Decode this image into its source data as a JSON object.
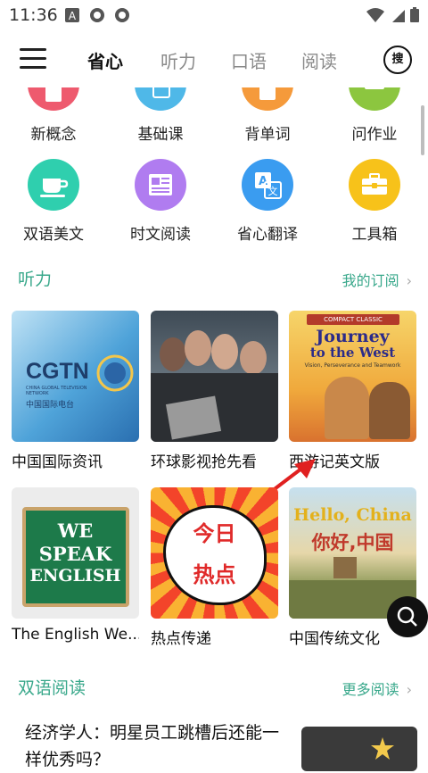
{
  "status": {
    "time": "11:36"
  },
  "tabs": [
    {
      "label": "省心"
    },
    {
      "label": "听力"
    },
    {
      "label": "口语"
    },
    {
      "label": "阅读"
    }
  ],
  "search_label": "搜",
  "grid_row1": [
    {
      "label": "新概念",
      "color": "#ee5a6e"
    },
    {
      "label": "基础课",
      "color": "#4fb8e8"
    },
    {
      "label": "背单词",
      "color": "#f59a3b"
    },
    {
      "label": "问作业",
      "color": "#8cc63f"
    }
  ],
  "grid_row2": [
    {
      "label": "双语美文",
      "color": "#2fcfae",
      "icon": "coffee-cup-icon"
    },
    {
      "label": "时文阅读",
      "color": "#b07cf0",
      "icon": "newspaper-icon"
    },
    {
      "label": "省心翻译",
      "color": "#3a9cf0",
      "icon": "translate-icon"
    },
    {
      "label": "工具箱",
      "color": "#f7c21a",
      "icon": "toolbox-icon"
    }
  ],
  "listening": {
    "title": "听力",
    "more": "我的订阅",
    "cards": [
      {
        "title": "中国国际资讯",
        "brand": "CGTN",
        "sub": "CHINA GLOBAL TELEVISION NETWORK",
        "cn": "中国国际电台"
      },
      {
        "title": "环球影视抢先看"
      },
      {
        "title": "西游记英文版",
        "tag": "COMPACT CLASSIC",
        "line1": "Journey",
        "line2": "to the West",
        "line3": "Vision, Perseverance and Teamwork"
      },
      {
        "title": "The English We...",
        "img_text": [
          "WE",
          "SPEAK",
          "ENGLISH"
        ]
      },
      {
        "title": "热点传递",
        "img_text": [
          "今日",
          "热点"
        ]
      },
      {
        "title": "中国传统文化",
        "img_text": [
          "Hello, China",
          "你好,中国"
        ]
      }
    ]
  },
  "reading": {
    "title": "双语阅读",
    "more": "更多阅读",
    "article": "经济学人：明星员工跳槽后还能一样优秀吗？"
  }
}
